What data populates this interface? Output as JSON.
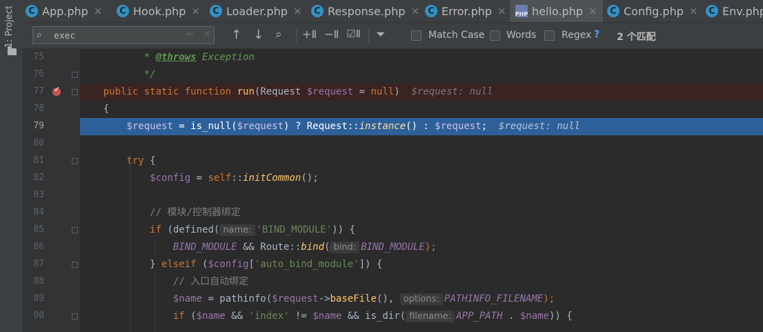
{
  "sidebar": {
    "project_label": "1: Project"
  },
  "tabs": [
    {
      "label": "App.php",
      "icon": "class-icon",
      "active": false
    },
    {
      "label": "Hook.php",
      "icon": "class-icon",
      "active": false
    },
    {
      "label": "Loader.php",
      "icon": "class-icon",
      "active": false
    },
    {
      "label": "Response.php",
      "icon": "class-icon",
      "active": false
    },
    {
      "label": "Error.php",
      "icon": "class-icon",
      "active": false
    },
    {
      "label": "hello.php",
      "icon": "php-file-icon",
      "active": true
    },
    {
      "label": "Config.php",
      "icon": "class-icon",
      "active": false
    },
    {
      "label": "Env.php",
      "icon": "class-icon",
      "active": false
    }
  ],
  "find": {
    "query": "exec",
    "match_case_label": "Match Case",
    "words_label": "Words",
    "regex_label": "Regex",
    "help_label": "?",
    "match_count": "2 个匹配",
    "match_case": false,
    "words": false,
    "regex": false
  },
  "editor": {
    "lines": [
      {
        "n": "75"
      },
      {
        "n": "76"
      },
      {
        "n": "77"
      },
      {
        "n": "78"
      },
      {
        "n": "79"
      },
      {
        "n": "80"
      },
      {
        "n": "81"
      },
      {
        "n": "82"
      },
      {
        "n": "83"
      },
      {
        "n": "84"
      },
      {
        "n": "85"
      },
      {
        "n": "86"
      },
      {
        "n": "87"
      },
      {
        "n": "88"
      },
      {
        "n": "89"
      },
      {
        "n": "90"
      }
    ],
    "current_line": "79",
    "breakpoint_line": "77",
    "code": {
      "l75_star": " * ",
      "l75_tag": "@throws",
      "l75_rest": " Exception",
      "l76": " */",
      "l77_k": "public static function ",
      "l77_fn": "run",
      "l77_p1": "(Request ",
      "l77_v": "$request",
      "l77_p2": " = ",
      "l77_null": "null",
      "l77_p3": ")",
      "l77_inline": "  $request: null",
      "l78": "{",
      "l79_v1": "$request",
      "l79_a": " = is_null(",
      "l79_v2": "$request",
      "l79_b": ") ? Request::",
      "l79_fn": "instance",
      "l79_c": "() : ",
      "l79_v3": "$request",
      "l79_d": ";",
      "l79_inline": "  $request: null",
      "l81_k": "try",
      "l81_b": " {",
      "l82_v": "$config",
      "l82_a": " = ",
      "l82_self": "self",
      "l82_b": "::",
      "l82_fn": "initCommon",
      "l82_c": "();",
      "l84": "// 模块/控制器绑定",
      "l85_k": "if",
      "l85_a": " (defined(",
      "l85_hint": "name:",
      "l85_s": "'BIND_MODULE'",
      "l85_b": ")) {",
      "l86_c": "BIND_MODULE",
      "l86_a": " && Route::",
      "l86_fn": "bind",
      "l86_b": "(",
      "l86_hint": "bind:",
      "l86_c2": "BIND_MODULE",
      "l86_d": ");",
      "l87_a": "} ",
      "l87_k": "elseif",
      "l87_b": " (",
      "l87_v": "$config",
      "l87_c": "[",
      "l87_s": "'auto_bind_module'",
      "l87_d": "]) {",
      "l88": "// 入口自动绑定",
      "l89_v": "$name",
      "l89_a": " = pathinfo(",
      "l89_v2": "$request",
      "l89_b": "->",
      "l89_fn": "baseFile",
      "l89_c": "(),",
      "l89_hint": "options:",
      "l89_const": "PATHINFO_FILENAME",
      "l89_d": ");",
      "l90_k": "if",
      "l90_a": " (",
      "l90_v": "$name",
      "l90_b": " && ",
      "l90_s": "'index'",
      "l90_c": " != ",
      "l90_v2": "$name",
      "l90_d": " && is_dir(",
      "l90_hint": "filename:",
      "l90_const": "APP_PATH",
      "l90_e": " . ",
      "l90_v3": "$name",
      "l90_f": ")) {"
    }
  }
}
